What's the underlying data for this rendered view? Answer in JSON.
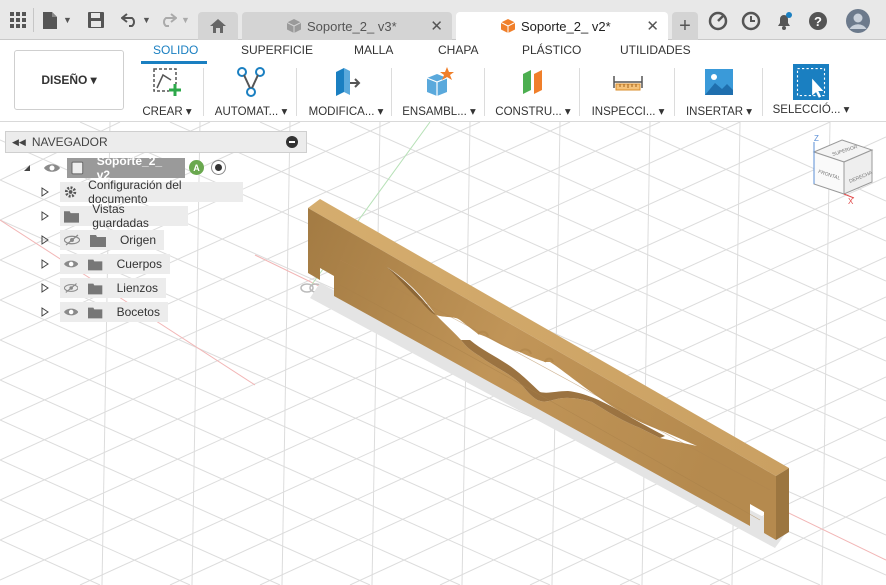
{
  "tabs": {
    "inactive_doc": "Soporte_2_ v3*",
    "active_doc": "Soporte_2_ v2*",
    "close_symbol": "✕",
    "new_tab_symbol": "+"
  },
  "workspace": {
    "label": "DISEÑO ▾"
  },
  "ribbon_tabs": [
    "SOLIDO",
    "SUPERFICIE",
    "MALLA",
    "CHAPA",
    "PLÁSTICO",
    "UTILIDADES"
  ],
  "tools": [
    "CREAR ▾",
    "AUTOMAT... ▾",
    "MODIFICA... ▾",
    "ENSAMBL... ▾",
    "CONSTRU... ▾",
    "INSPECCI... ▾",
    "INSERTAR ▾",
    "SELECCIÓ... ▾"
  ],
  "navigator": {
    "title": "NAVEGADOR",
    "root": "Soporte_2_ v2",
    "items": [
      "Configuración del documento",
      "Vistas guardadas",
      "Origen",
      "Cuerpos",
      "Lienzos",
      "Bocetos"
    ]
  },
  "viewcube": {
    "top": "SUPERIOR",
    "front": "FRONTAL",
    "right": "DERECHA",
    "axis_x": "X",
    "axis_z": "Z"
  },
  "colors": {
    "accent": "#1a7fc1",
    "wood": "#b88d4f",
    "tab_bar": "#e8e8e8"
  }
}
